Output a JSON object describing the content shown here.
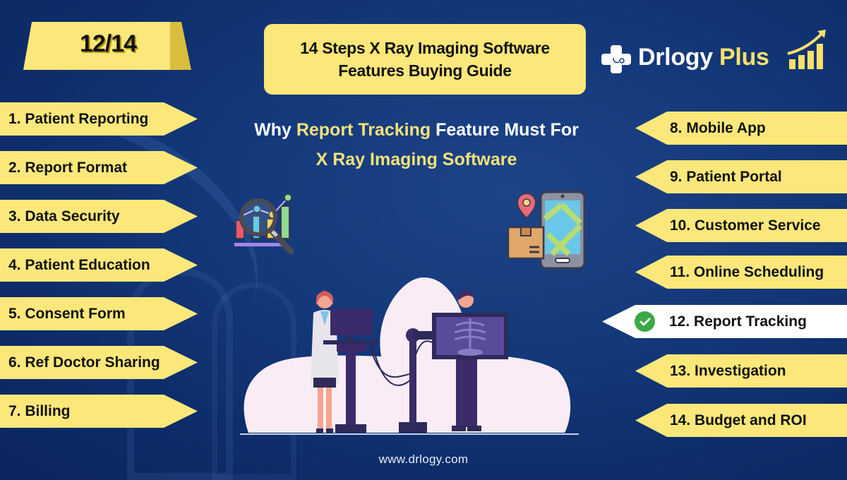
{
  "step_counter": "12/14",
  "title": {
    "line1": "14 Steps X Ray Imaging Software",
    "line2": "Features Buying Guide"
  },
  "brand": {
    "name": "Drlogy",
    "suffix": "Plus",
    "logo_icon": "medical-cross-stethoscope-icon",
    "chart_icon": "growth-bar-chart-icon"
  },
  "subtitle": {
    "prefix": "Why ",
    "highlight": "Report Tracking",
    "suffix": " Feature Must For",
    "line2": "X Ray Imaging Software"
  },
  "left_steps": [
    {
      "label": "1. Patient Reporting"
    },
    {
      "label": "2. Report Format"
    },
    {
      "label": "3. Data Security"
    },
    {
      "label": "4. Patient Education"
    },
    {
      "label": "5. Consent Form"
    },
    {
      "label": "6. Ref Doctor Sharing"
    },
    {
      "label": "7. Billing"
    }
  ],
  "right_steps": [
    {
      "label": "8. Mobile App",
      "active": false
    },
    {
      "label": "9. Patient Portal",
      "active": false
    },
    {
      "label": "10. Customer Service",
      "active": false
    },
    {
      "label": "11. Online Scheduling",
      "active": false
    },
    {
      "label": "12. Report Tracking",
      "active": true
    },
    {
      "label": "13. Investigation",
      "active": false
    },
    {
      "label": "14. Budget and ROI",
      "active": false
    }
  ],
  "colors": {
    "badge_yellow": "#fbe77a",
    "active_badge": "#ffffff",
    "check_green": "#3aa945",
    "highlight_text": "#f3e27a",
    "background_navy": "#153a7c"
  },
  "footer": {
    "url": "www.drlogy.com"
  }
}
